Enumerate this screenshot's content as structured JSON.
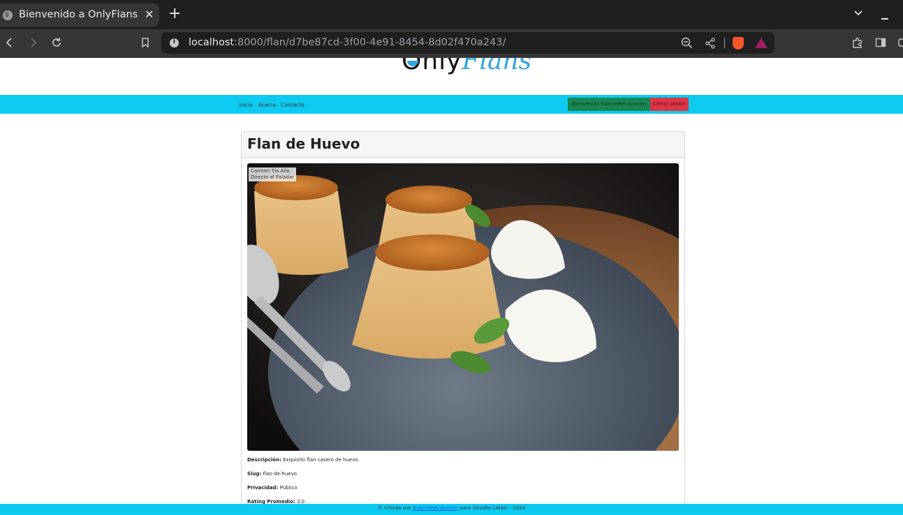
{
  "browser": {
    "tab_title": "Bienvenido a OnlyFlans",
    "tab_close": "✕",
    "new_tab": "+",
    "url_host": "localhost",
    "url_rest": ":8000/flan/d7be87cd-3f00-4e91-8454-8d02f470a243/"
  },
  "site": {
    "logo_only": "Only",
    "logo_flans": "Flans",
    "nav": {
      "inicio": "Inicio",
      "acerca": "Acerca",
      "contacto": "Contacto",
      "welcome": "Bienvenido GabrielRecabarren",
      "logout": "Cerrar sesión"
    },
    "colors": {
      "navbar": "#0dcaf0",
      "welcome_button": "#198754",
      "logout_button": "#dc3545",
      "logo_accent": "#2fa6e0"
    }
  },
  "flan": {
    "title": "Flan de Huevo",
    "image_credit_line1": "Carmen Tía Alía",
    "image_credit_line2": "Directo al Paladar",
    "description_label": "Descripción:",
    "description": "Exquisito flan casero de huevo",
    "slug_label": "Slug:",
    "slug": "flan-de-huevo",
    "privacy_label": "Privacidad:",
    "privacy": "Público",
    "rating_label": "Rating Promedio:",
    "rating": "3.0"
  },
  "footer": {
    "prefix": "© Creado por",
    "author": "GabrielRecabarren",
    "suffix": "para Desafío Latam - 2024"
  }
}
